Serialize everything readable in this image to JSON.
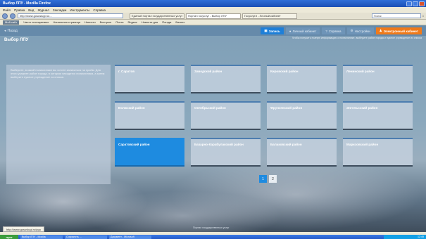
{
  "browser": {
    "window_title": "Выбор ЛПУ - Mozilla Firefox",
    "menu": [
      "Файл",
      "Правка",
      "Вид",
      "Журнал",
      "Закладки",
      "Инструменты",
      "Справка"
    ],
    "url": "http://www.gosuslugi.ru/...",
    "tabs": [
      "Единый портал государственных услуг",
      "Портал госуслуг - Выбор ЛПУ",
      "Госуслуги - Личный кабинет"
    ],
    "search_placeholder": "Поиск",
    "bookmarks": [
      "Мой сайт",
      "Часто посещаемые",
      "Начальная страница",
      "Новости",
      "Быстрые",
      "Почта",
      "Яндекс",
      "Новости дня",
      "Погода",
      "Бизнес"
    ]
  },
  "page": {
    "back_label": "Назад",
    "title": "Выбор ЛПУ",
    "nav": {
      "zapis": "Запись",
      "personal": "Личный кабинет",
      "help": "Справка",
      "settings": "Настройки",
      "electronic": "Электронный кабинет"
    },
    "top_info": "Чтобы получить полную информацию о поликлинике, выберите район города и нужное учреждение из списка",
    "side_text": "Выберите, в какой поликлинике вы хотите записаться на приём. Для этого укажите район города, в котором находится поликлиника, а затем выберите нужное учреждение из списка.",
    "districts": [
      "г. Саратов",
      "Заводской район",
      "Кировский район",
      "Ленинский район",
      "Волжский район",
      "Октябрьский район",
      "Фрунзенский район",
      "Энгельсский район",
      "Саратовский район",
      "Базарно-Карабулакский район",
      "Балаковский район",
      "Марксовский район"
    ],
    "active_district_index": 8,
    "pages": [
      "1",
      "2"
    ],
    "current_page": "1",
    "footer": "Портал государственных услуг"
  },
  "status": {
    "tooltip": "http://www.gosuslugi.ru/pgu"
  },
  "taskbar": {
    "start": "пуск",
    "tasks": [
      "Выбор ЛПУ - Mozilla",
      "Сохранить ...",
      "Документ - Microsoft"
    ],
    "clock": "12:49"
  }
}
